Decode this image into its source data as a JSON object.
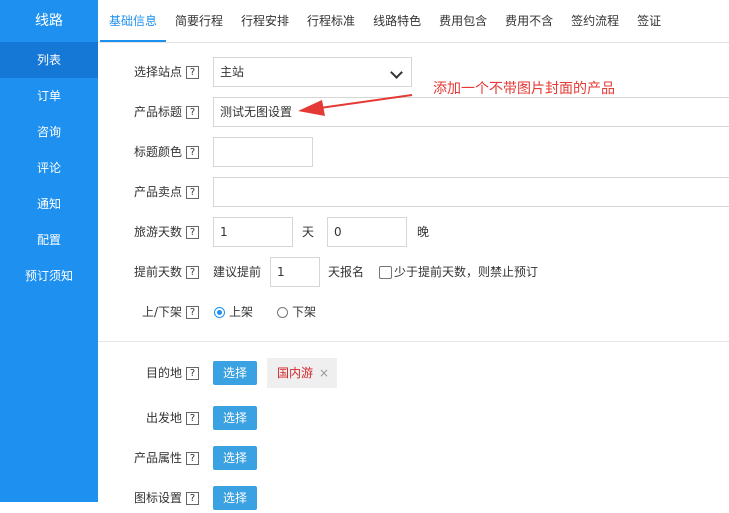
{
  "sidebar": {
    "title": "线路",
    "items": [
      {
        "label": "列表",
        "active": true
      },
      {
        "label": "订单"
      },
      {
        "label": "咨询"
      },
      {
        "label": "评论"
      },
      {
        "label": "通知"
      },
      {
        "label": "配置"
      },
      {
        "label": "预订须知"
      }
    ]
  },
  "tabs": [
    "基础信息",
    "简要行程",
    "行程安排",
    "行程标准",
    "线路特色",
    "费用包含",
    "费用不含",
    "签约流程",
    "签证"
  ],
  "form": {
    "help_icon": "?",
    "site": {
      "label": "选择站点",
      "value": "主站"
    },
    "title": {
      "label": "产品标题",
      "value": "测试无图设置"
    },
    "title_color": {
      "label": "标题颜色",
      "value": ""
    },
    "selling_point": {
      "label": "产品卖点",
      "value": ""
    },
    "days": {
      "label": "旅游天数",
      "day_value": "1",
      "day_unit": "天",
      "night_value": "0",
      "night_unit": "晚"
    },
    "advance": {
      "label": "提前天数",
      "prefix": "建议提前",
      "value": "1",
      "suffix": "天报名",
      "checkbox_label": "少于提前天数，则禁止预订"
    },
    "shelf": {
      "label": "上/下架",
      "on": "上架",
      "off": "下架",
      "selected": "上架"
    },
    "destination": {
      "label": "目的地",
      "button": "选择",
      "tag": "国内游",
      "tag_close": "×"
    },
    "departure": {
      "label": "出发地",
      "button": "选择"
    },
    "attributes": {
      "label": "产品属性",
      "button": "选择"
    },
    "icon_setting": {
      "label": "图标设置",
      "button": "选择"
    }
  },
  "annotation": {
    "text": "添加一个不带图片封面的产品",
    "color": "#e53935"
  },
  "colors": {
    "sidebar": "#1e90f0",
    "sidebar_active": "#1577d6",
    "button": "#3aa1e2",
    "tag_text": "#d3262b"
  }
}
